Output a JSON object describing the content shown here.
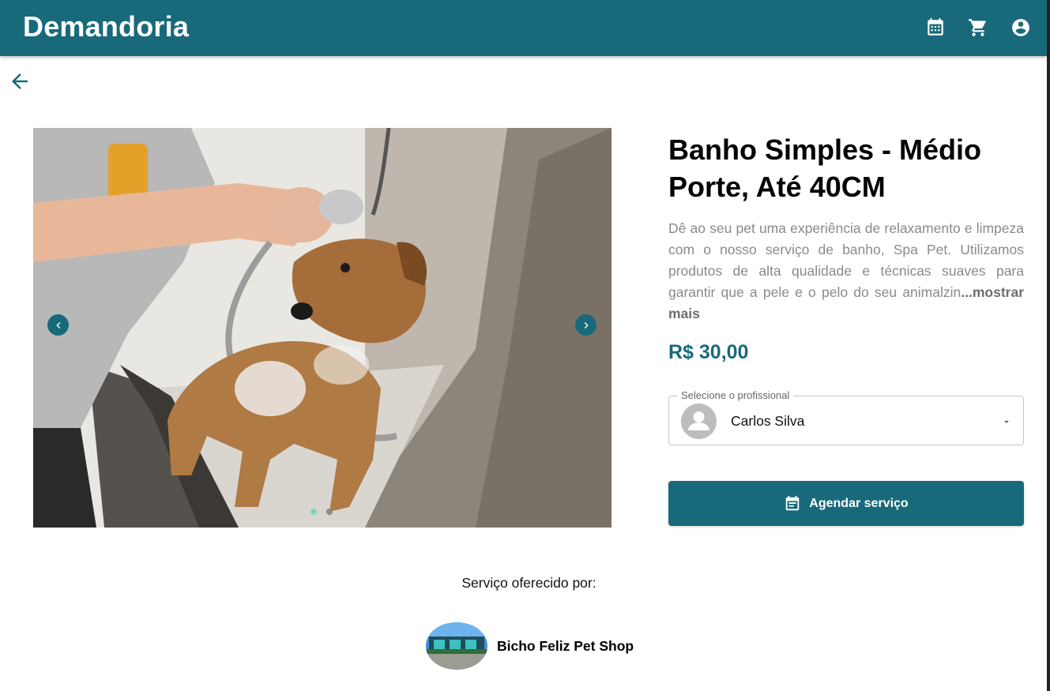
{
  "appbar": {
    "brand": "Demandoria",
    "icons": [
      "calendar-icon",
      "cart-icon",
      "account-icon"
    ],
    "color": "#186a7b"
  },
  "product": {
    "title": "Banho Simples - Médio Porte, Até 40CM",
    "description": "Dê ao seu pet uma experiência de relaxamento e limpeza com o nosso serviço de banho, Spa Pet. Utilizamos produtos de alta qualidade e técnicas suaves para garantir que a pele e o pelo do seu animalzin",
    "more_label": "...mostrar mais",
    "price": "R$ 30,00"
  },
  "carousel": {
    "slide_count": 2,
    "active_slide": 1
  },
  "professional_select": {
    "label": "Selecione o profissional",
    "value": "Carlos Silva"
  },
  "cta": {
    "label": "Agendar serviço"
  },
  "provider": {
    "heading": "Serviço oferecido por:",
    "name": "Bicho Feliz Pet Shop"
  }
}
